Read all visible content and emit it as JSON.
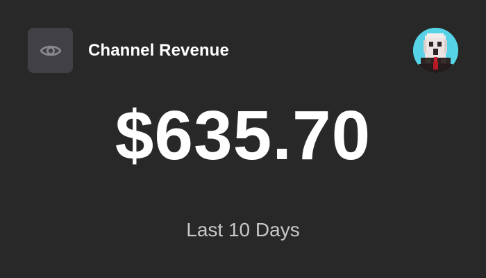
{
  "widget": {
    "title": "Channel Revenue",
    "amount": "$635.70",
    "period": "Last 10 Days"
  },
  "icons": {
    "visibility": "eye-icon",
    "avatar": "user-avatar"
  },
  "colors": {
    "background": "#282828",
    "toggle_background": "#404045",
    "icon": "#8a8a8e",
    "text_primary": "#ffffff",
    "text_secondary": "#c8c8c8",
    "avatar_background": "#56d3e6"
  }
}
